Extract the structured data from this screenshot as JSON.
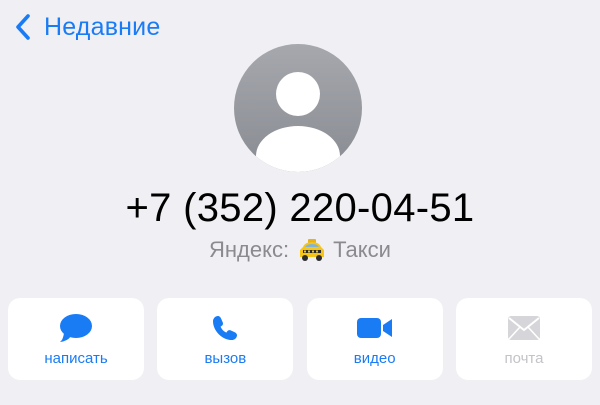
{
  "nav": {
    "back_label": "Недавние"
  },
  "contact": {
    "phone": "+7 (352) 220-04-51",
    "label_prefix": "Яндекс:",
    "label_suffix": "Такси"
  },
  "actions": [
    {
      "label": "написать",
      "icon": "message-icon",
      "enabled": true
    },
    {
      "label": "вызов",
      "icon": "phone-icon",
      "enabled": true
    },
    {
      "label": "видео",
      "icon": "video-icon",
      "enabled": true
    },
    {
      "label": "почта",
      "icon": "mail-icon",
      "enabled": false
    }
  ],
  "colors": {
    "accent": "#1a7cf5",
    "background": "#efeff4",
    "disabled": "#c3c3c8",
    "secondary_text": "#8a8a8f"
  }
}
